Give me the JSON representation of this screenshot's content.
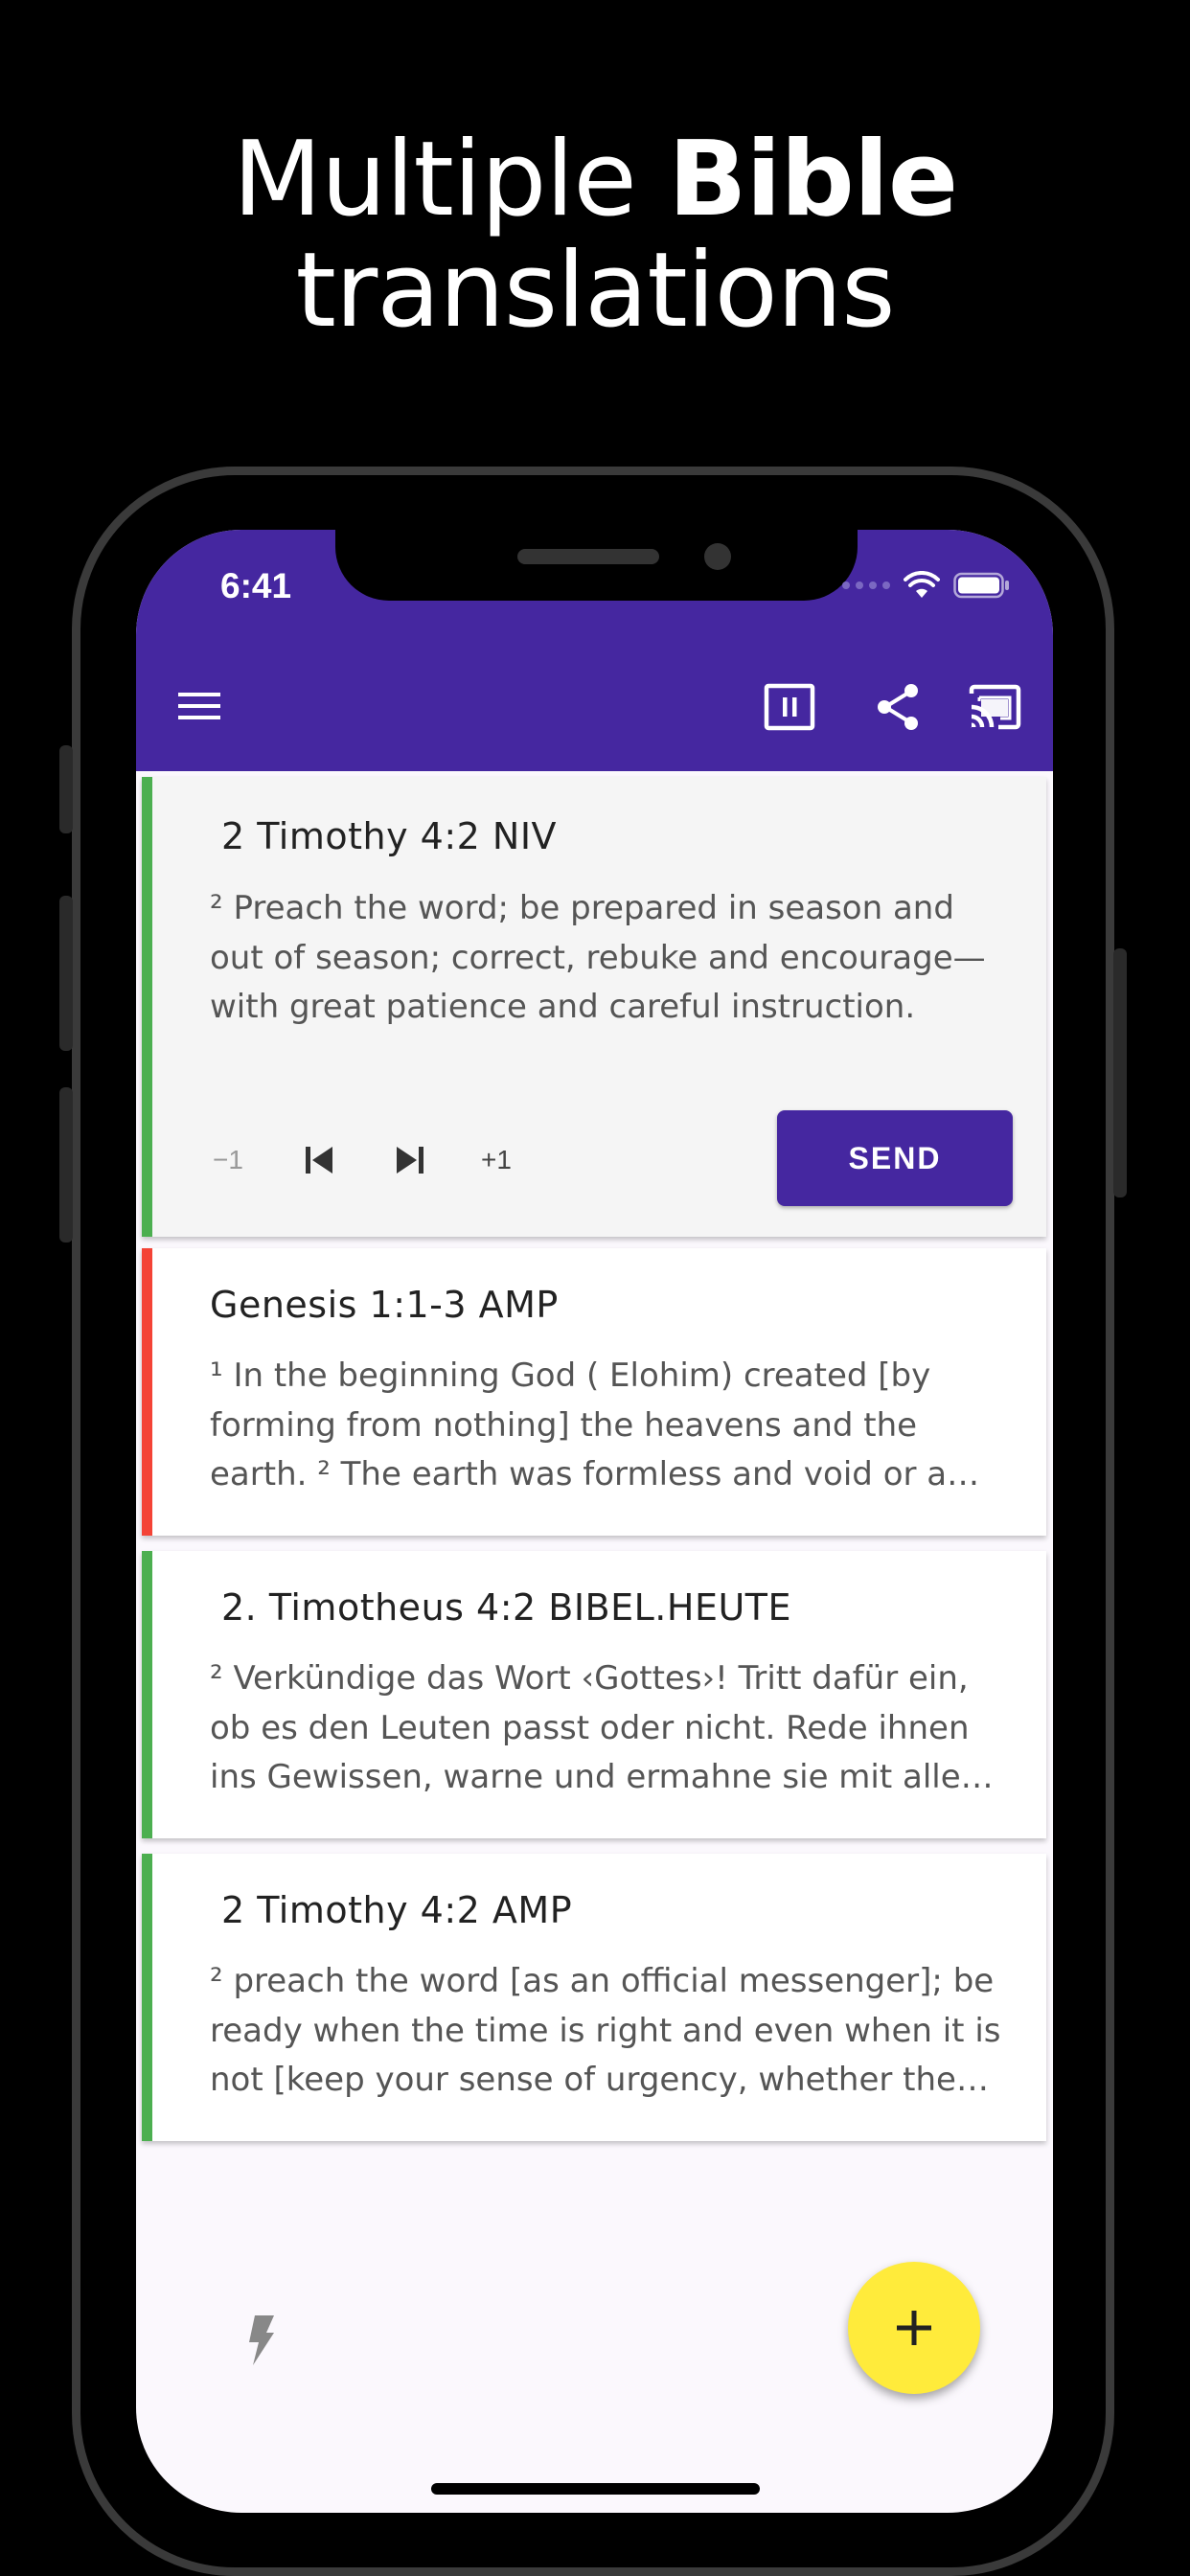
{
  "marketing": {
    "headline_light": "Multiple",
    "headline_bold": "Bible",
    "headline_line2": "translations"
  },
  "status_bar": {
    "time": "6:41"
  },
  "appbar": {
    "background": "#4527a0",
    "icons": [
      "menu-icon",
      "pause-icon",
      "share-icon",
      "cast-icon"
    ]
  },
  "cards": [
    {
      "title": "2 Timothy 4:2 NIV",
      "body": "² Preach the word; be prepared in season and out of season; correct, rebuke and encourage—with great patience and careful instruction.",
      "accent": "#4caf50",
      "expanded": true
    },
    {
      "title": "Genesis 1:1-3 AMP",
      "body": "¹ In the beginning God ( Elohim) created [by forming from nothing] the heavens and the earth.  ² The earth was formless and void or a waste and emptiness, and darkness was upon the face of the deep.",
      "accent": "#f44336",
      "expanded": false
    },
    {
      "title": "2. Timotheus 4:2 BIBEL.HEUTE",
      "body": "² Verkündige das Wort ‹Gottes›! Tritt dafür ein, ob es den Leuten passt oder nicht. Rede ihnen ins Gewissen, warne und ermahne sie mit aller Geduld.",
      "accent": "#4caf50",
      "expanded": false
    },
    {
      "title": "2 Timothy 4:2 AMP",
      "body": "² preach the word [as an official messenger]; be ready when the time is right and even when it is not [keep your sense of urgency, whether the opportunity seems favorable or not].",
      "accent": "#4caf50",
      "expanded": false
    }
  ],
  "controls": {
    "minus_label": "−1",
    "plus_label": "+1",
    "send_label": "SEND"
  },
  "fab": {
    "color": "#ffeb3b",
    "icon": "plus-icon"
  }
}
